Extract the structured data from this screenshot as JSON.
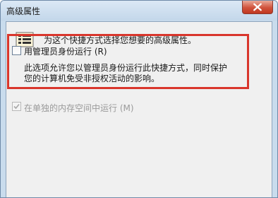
{
  "window": {
    "title": "高级属性"
  },
  "header": {
    "text": "为这个快捷方式选择您想要的高级属性。",
    "icon": "properties-list-icon"
  },
  "run_as_admin": {
    "label": "用管理员身份运行",
    "hotkey": "(R)",
    "checked": false,
    "description_line1": "此选项允许您以管理员身份运行此快捷方式，同时保护",
    "description_line2": "您的计算机免受非授权活动的影响。"
  },
  "separate_memory": {
    "label": "在单独的内存空间中运行",
    "hotkey": "(M)",
    "checked": true,
    "enabled": false
  },
  "colors": {
    "highlight_border": "#d9362c",
    "window_frame": "#c9dced",
    "client_bg": "#f0f0f0"
  }
}
